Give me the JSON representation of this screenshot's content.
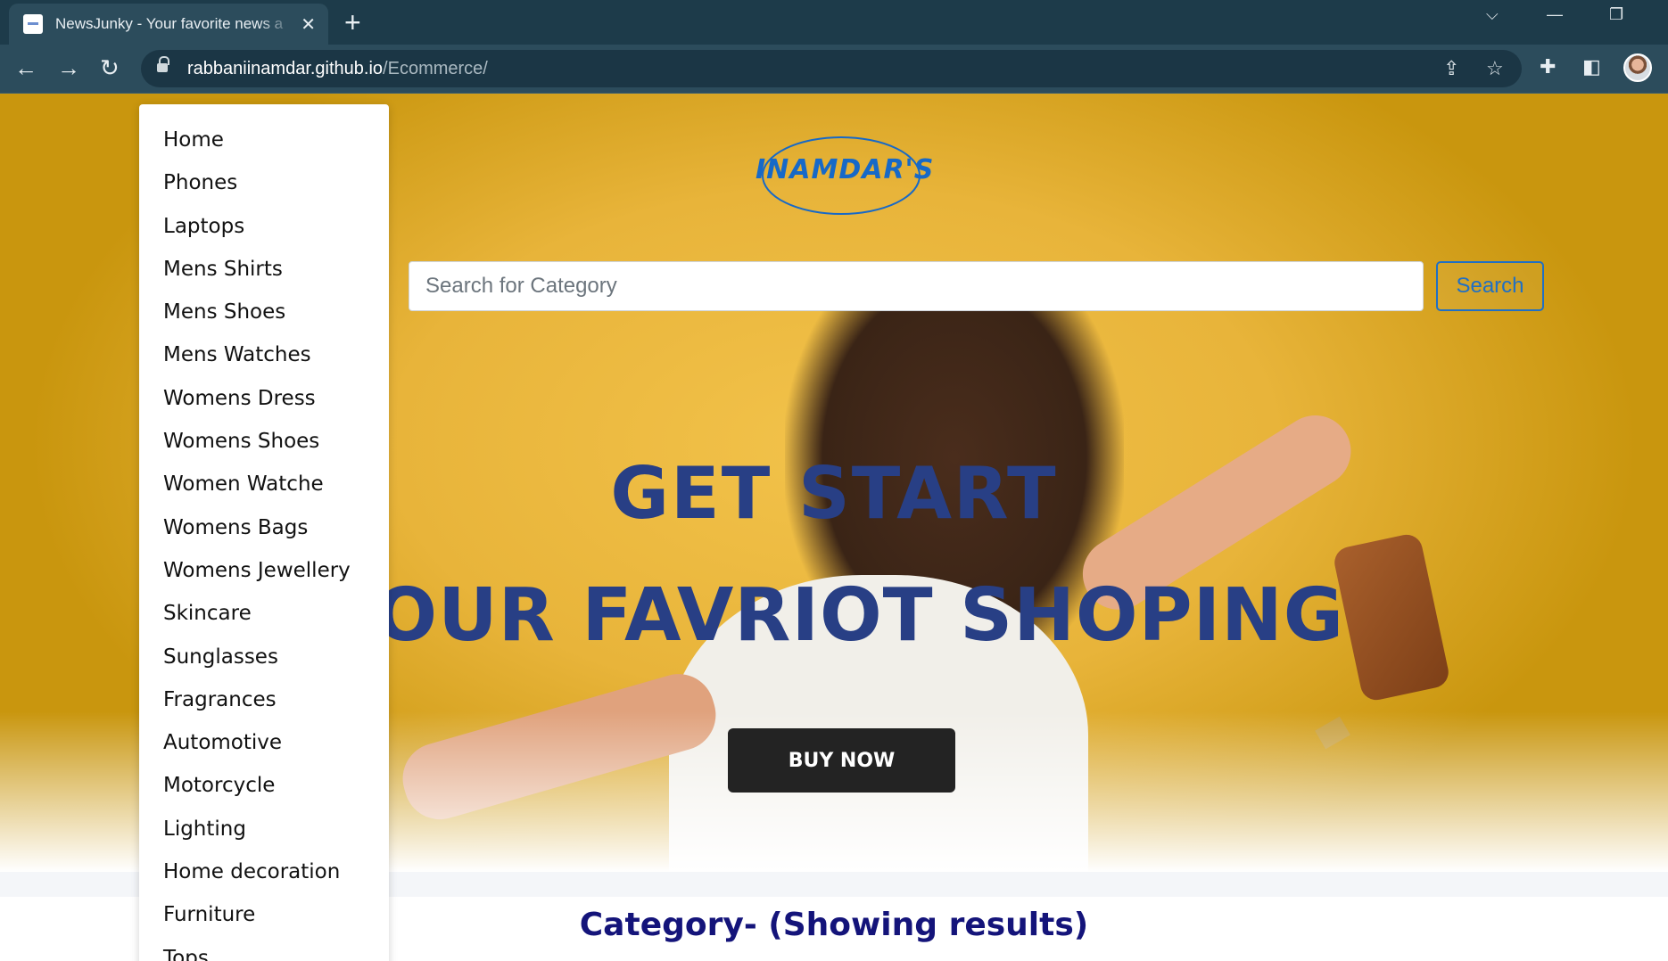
{
  "browser": {
    "tab_title": "NewsJunky - Your favorite news a",
    "url_host": "rabbaniinamdar.github.io",
    "url_path": "/Ecommerce/"
  },
  "icons": [
    "page-favicon-icon",
    "close-icon",
    "plus-icon",
    "chevron-down-icon",
    "minimize-icon",
    "restore-icon",
    "back-arrow-icon",
    "forward-arrow-icon",
    "reload-icon",
    "lock-icon",
    "share-icon",
    "star-icon",
    "extensions-puzzle-icon",
    "side-panel-icon",
    "profile-avatar"
  ],
  "colors": {
    "accent_blue": "#1f6fc5",
    "headline_navy": "#283f85",
    "hero_yellow": "#e8b43a",
    "button_dark": "#232323",
    "category_heading": "#14147a"
  },
  "site": {
    "logo_text": "INAMDAR'S",
    "search": {
      "placeholder": "Search for Category",
      "value": "",
      "button_label": "Search"
    },
    "headline_line1": "GET START",
    "headline_line2": "YOUR FAVRIOT SHOPING",
    "buy_button": "BUY NOW",
    "category_heading": "Category- (Showing results)"
  },
  "menu": {
    "items": [
      "Home",
      "Phones",
      "Laptops",
      "Mens Shirts",
      "Mens Shoes",
      "Mens Watches",
      "Womens Dress",
      "Womens Shoes",
      "Women Watche",
      "Womens Bags",
      "Womens Jewellery",
      "Skincare",
      "Sunglasses",
      "Fragrances",
      "Automotive",
      "Motorcycle",
      "Lighting",
      "Home decoration",
      "Furniture",
      "Tops"
    ]
  }
}
